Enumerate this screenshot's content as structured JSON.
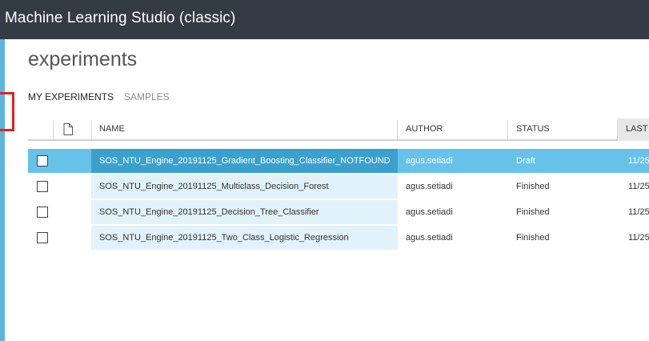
{
  "app": {
    "title": "Machine Learning Studio (classic)"
  },
  "page": {
    "title": "experiments"
  },
  "tabs": [
    {
      "label": "MY EXPERIMENTS",
      "active": true
    },
    {
      "label": "SAMPLES",
      "active": false
    }
  ],
  "table": {
    "columns": {
      "name": "NAME",
      "author": "AUTHOR",
      "status": "STATUS",
      "last": "LAST"
    },
    "header_icon": "document-icon",
    "rows": [
      {
        "name": "SOS_NTU_Engine_20191125_Gradient_Boosting_Classifier_NOTFOUND",
        "author": "agus.setiadi",
        "status": "Draft",
        "last": "11/25",
        "selected": true
      },
      {
        "name": "SOS_NTU_Engine_20191125_Multiclass_Decision_Forest",
        "author": "agus.setiadi",
        "status": "Finished",
        "last": "11/25",
        "selected": false
      },
      {
        "name": "SOS_NTU_Engine_20191125_Decision_Tree_Classifier",
        "author": "agus.setiadi",
        "status": "Finished",
        "last": "11/25",
        "selected": false
      },
      {
        "name": "SOS_NTU_Engine_20191125_Two_Class_Logistic_Regression",
        "author": "agus.setiadi",
        "status": "Finished",
        "last": "11/25",
        "selected": false
      }
    ]
  },
  "colors": {
    "titlebar": "#353b44",
    "accent": "#5fb4dd",
    "selected_row": "#67c2ea",
    "selected_name": "#3aa1cf",
    "name_cell": "#e2f2fb",
    "highlight_marker": "#e32028"
  }
}
